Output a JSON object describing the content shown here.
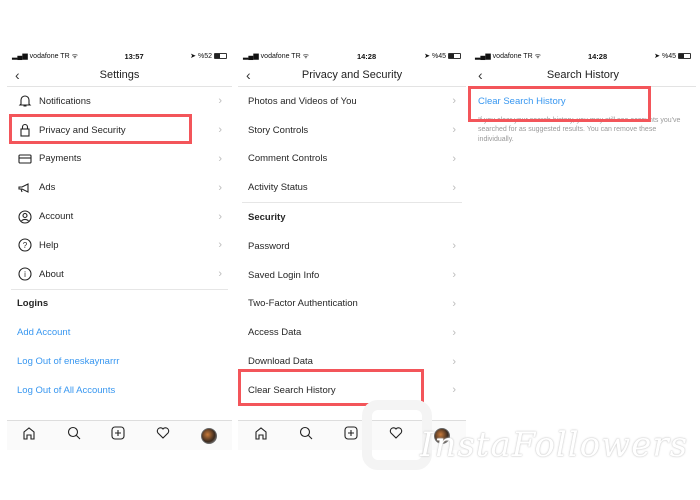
{
  "panels": [
    {
      "status": {
        "carrier": "vodafone TR",
        "time": "13:57",
        "battery": "%52"
      },
      "title": "Settings",
      "items": [
        {
          "label": "Notifications",
          "icon": "bell-icon"
        },
        {
          "label": "Privacy and Security",
          "icon": "lock-icon"
        },
        {
          "label": "Payments",
          "icon": "credit-card-icon"
        },
        {
          "label": "Ads",
          "icon": "megaphone-icon"
        },
        {
          "label": "Account",
          "icon": "account-icon"
        },
        {
          "label": "Help",
          "icon": "help-icon"
        },
        {
          "label": "About",
          "icon": "info-icon"
        }
      ],
      "logins_header": "Logins",
      "links": [
        "Add Account",
        "Log Out of eneskaynarrr",
        "Log Out of All Accounts"
      ]
    },
    {
      "status": {
        "carrier": "vodafone TR",
        "time": "14:28",
        "battery": "%45"
      },
      "title": "Privacy and Security",
      "items": [
        "Photos and Videos of You",
        "Story Controls",
        "Comment Controls",
        "Activity Status"
      ],
      "security_header": "Security",
      "security_items": [
        "Password",
        "Saved Login Info",
        "Two-Factor Authentication",
        "Access Data",
        "Download Data",
        "Clear Search History"
      ]
    },
    {
      "status": {
        "carrier": "vodafone TR",
        "time": "14:28",
        "battery": "%45"
      },
      "title": "Search History",
      "action": "Clear Search History",
      "note": "If you clear your search history, you may still see accounts you've searched for as suggested results. You can remove these individually."
    }
  ],
  "tabbar": [
    "home-icon",
    "search-icon",
    "add-post-icon",
    "heart-icon",
    "profile-avatar"
  ],
  "watermark": "InstaFollowers",
  "colors": {
    "highlight": "#f3555a",
    "link": "#3897f0"
  }
}
